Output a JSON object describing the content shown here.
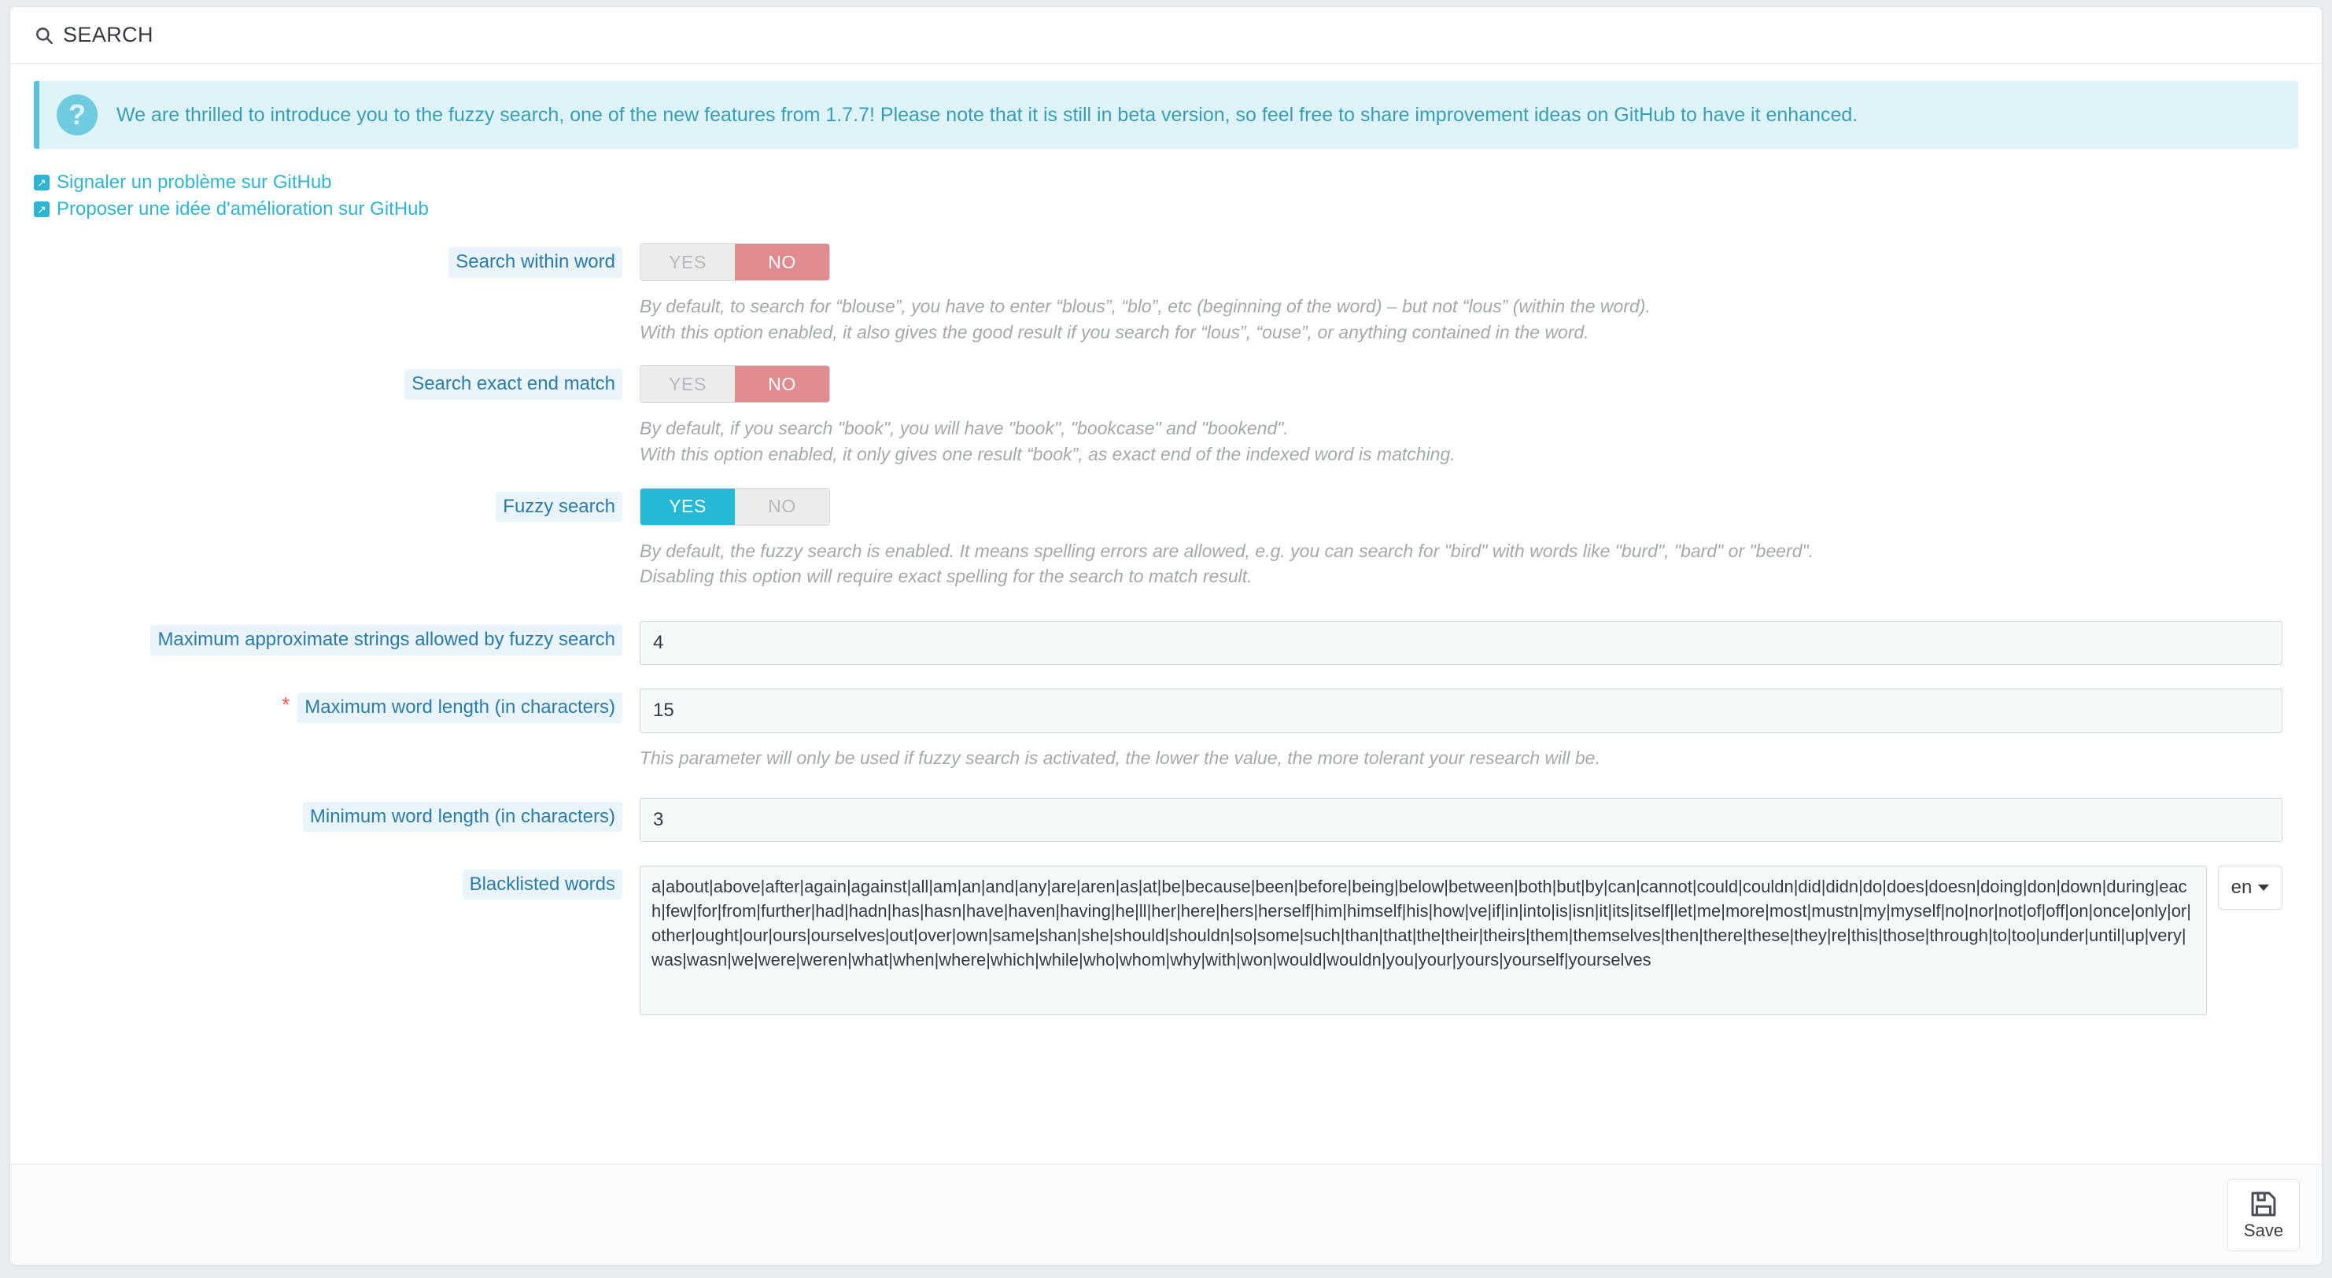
{
  "panel": {
    "title": "SEARCH",
    "title_icon": "search-icon"
  },
  "alert": {
    "icon": "question-mark-icon",
    "glyph": "?",
    "text": "We are thrilled to introduce you to the fuzzy search, one of the new features from 1.7.7! Please note that it is still in beta version, so feel free to share improvement ideas on GitHub to have it enhanced.",
    "background_color": "#dff4f9",
    "accent_color": "#5bc0de"
  },
  "links": [
    {
      "label": "Signaler un problème sur GitHub",
      "icon": "external-link-icon"
    },
    {
      "label": "Proposer une idée d'amélioration sur GitHub",
      "icon": "external-link-icon"
    }
  ],
  "switch_options": {
    "yes": "YES",
    "no": "NO"
  },
  "fields": {
    "search_within_word": {
      "label": "Search within word",
      "value": "NO",
      "help_line_1": "By default, to search for “blouse”, you have to enter “blous”, “blo”, etc (beginning of the word) – but not “lous” (within the word).",
      "help_line_2": "With this option enabled, it also gives the good result if you search for “lous”, “ouse”, or anything contained in the word."
    },
    "search_exact_end_match": {
      "label": "Search exact end match",
      "value": "NO",
      "help_line_1": "By default, if you search \"book\", you will have \"book\", \"bookcase\" and \"bookend\".",
      "help_line_2": "With this option enabled, it only gives one result “book”, as exact end of the indexed word is matching."
    },
    "fuzzy_search": {
      "label": "Fuzzy search",
      "value": "YES",
      "help_line_1": "By default, the fuzzy search is enabled. It means spelling errors are allowed, e.g. you can search for \"bird\" with words like \"burd\", \"bard\" or \"beerd\".",
      "help_line_2": "Disabling this option will require exact spelling for the search to match result."
    },
    "max_approximate_strings": {
      "label": "Maximum approximate strings allowed by fuzzy search",
      "value": "4"
    },
    "max_word_length": {
      "label": "Maximum word length (in characters)",
      "value": "15",
      "required": true,
      "required_marker": "*",
      "help_line_1": "This parameter will only be used if fuzzy search is activated, the lower the value, the more tolerant your research will be."
    },
    "min_word_length": {
      "label": "Minimum word length (in characters)",
      "value": "3"
    },
    "blacklisted_words": {
      "label": "Blacklisted words",
      "value": "a|about|above|after|again|against|all|am|an|and|any|are|aren|as|at|be|because|been|before|being|below|between|both|but|by|can|cannot|could|couldn|did|didn|do|does|doesn|doing|don|down|during|each|few|for|from|further|had|hadn|has|hasn|have|haven|having|he|ll|her|here|hers|herself|him|himself|his|how|ve|if|in|into|is|isn|it|its|itself|let|me|more|most|mustn|my|myself|no|nor|not|of|off|on|once|only|or|other|ought|our|ours|ourselves|out|over|own|same|shan|she|should|shouldn|so|some|such|than|that|the|their|theirs|them|themselves|then|there|these|they|re|this|those|through|to|too|under|until|up|very|was|wasn|we|were|weren|what|when|where|which|while|who|whom|why|with|won|would|wouldn|you|your|yours|yourself|yourselves",
      "language": "en"
    }
  },
  "footer": {
    "save_label": "Save",
    "save_icon": "floppy-disk-icon"
  }
}
